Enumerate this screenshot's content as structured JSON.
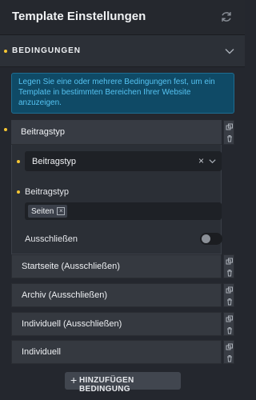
{
  "header": {
    "title": "Template Einstellungen",
    "refresh_icon": "refresh-icon"
  },
  "section": {
    "label": "BEDINGUNGEN",
    "toggle_icon": "chevron-down-icon"
  },
  "info": {
    "text": "Legen Sie eine oder mehrere Bedingungen fest, um ein Template in bestimmten Bereichen Ihrer Website anzuzeigen."
  },
  "condition": {
    "title": "Beitragstyp",
    "select_value": "Beitragstyp",
    "field_label": "Beitragstyp",
    "tags": [
      "Seiten"
    ],
    "exclude_label": "Ausschließen",
    "exclude_on": false
  },
  "rows": [
    "Startseite (Ausschließen)",
    "Archiv (Ausschließen)",
    "Individuell (Ausschließen)",
    "Individuell"
  ],
  "add_button": {
    "label": "HINZUFÜGEN BEDINGUNG"
  },
  "colors": {
    "accent_dot": "#f6c633",
    "info_bg": "#0f4a66",
    "info_text": "#55c3f2"
  }
}
